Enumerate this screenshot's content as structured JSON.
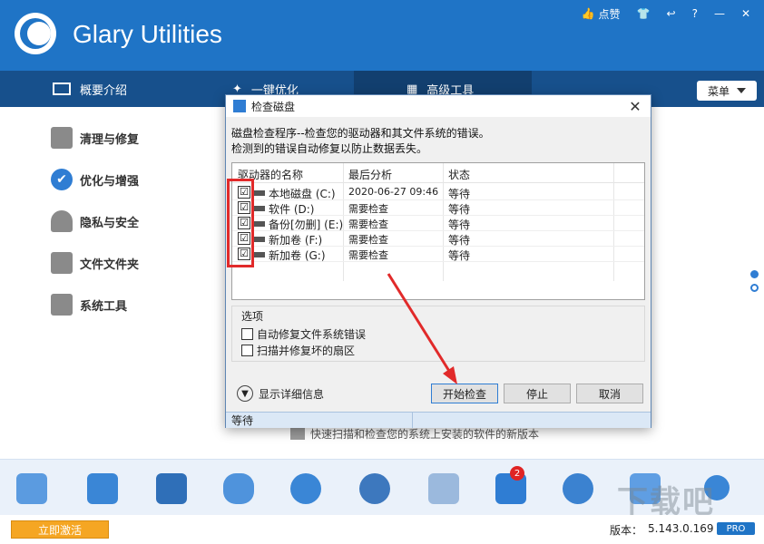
{
  "app": {
    "title": "Glary Utilities"
  },
  "top_controls": {
    "like_label": "点赞"
  },
  "tabs": [
    {
      "label": "概要介绍",
      "icon": "monitor-icon"
    },
    {
      "label": "一键优化",
      "icon": "wand-icon"
    },
    {
      "label": "高级工具",
      "icon": "grid-icon"
    }
  ],
  "menu": {
    "label": "菜单"
  },
  "sidebar": {
    "items": [
      {
        "label": "清理与修复",
        "icon": "broom-icon"
      },
      {
        "label": "优化与增强",
        "icon": "check-circle-icon"
      },
      {
        "label": "隐私与安全",
        "icon": "user-lock-icon"
      },
      {
        "label": "文件文件夹",
        "icon": "folder-icon"
      },
      {
        "label": "系统工具",
        "icon": "toolbox-icon"
      }
    ]
  },
  "status_note": "快速扫描和检查您的系统上安装的软件的新版本",
  "dialog": {
    "title": "检查磁盘",
    "desc_line1": "磁盘检查程序--检查您的驱动器和其文件系统的错误。",
    "desc_line2": "检测到的错误自动修复以防止数据丢失。",
    "columns": [
      "驱动器的名称",
      "最后分析",
      "状态"
    ],
    "rows": [
      {
        "name": "本地磁盘 (C:)",
        "last": "2020-06-27 09:46",
        "state": "等待",
        "checked": "☑"
      },
      {
        "name": "软件 (D:)",
        "last": "需要检查",
        "state": "等待",
        "checked": "☑"
      },
      {
        "name": "备份[勿删] (E:)",
        "last": "需要检查",
        "state": "等待",
        "checked": "☑"
      },
      {
        "name": "新加卷 (F:)",
        "last": "需要检查",
        "state": "等待",
        "checked": "☑"
      },
      {
        "name": "新加卷 (G:)",
        "last": "需要检查",
        "state": "等待",
        "checked": "☑"
      }
    ],
    "options_legend": "选项",
    "option1": "自动修复文件系统错误",
    "option2": "扫描并修复坏的扇区",
    "details_label": "显示详细信息",
    "buttons": {
      "start": "开始检查",
      "stop": "停止",
      "cancel": "取消"
    },
    "status": "等待"
  },
  "toolbar": {
    "badge_count": "2"
  },
  "footer": {
    "activate_label": "立即激活",
    "version_label": "版本：",
    "version_value": "5.143.0.169",
    "pro_label": "PRO"
  },
  "colors": {
    "brand": "#1f74c6",
    "tab_bar": "#17508c",
    "annotation_red": "#e12a2a"
  }
}
